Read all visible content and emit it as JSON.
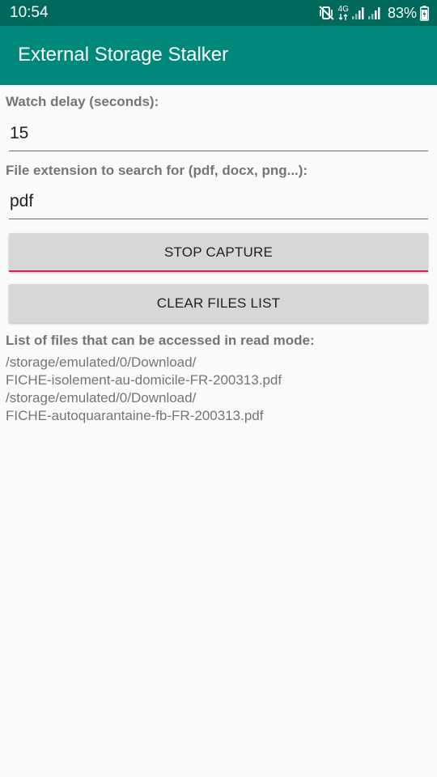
{
  "status_bar": {
    "time": "10:54",
    "network": "4G",
    "battery": "83%",
    "icons": [
      "mute-vibrate-icon",
      "network-4g-icon",
      "signal-icon",
      "battery-icon"
    ]
  },
  "app_bar": {
    "title": "External Storage Stalker"
  },
  "form": {
    "delay_label": "Watch delay (seconds):",
    "delay_value": "15",
    "extension_label": "File extension to search for (pdf, docx, png...):",
    "extension_value": "pdf"
  },
  "buttons": {
    "stop_capture": "STOP CAPTURE",
    "clear_files": "CLEAR FILES LIST"
  },
  "files": {
    "heading": "List of files that can be accessed in read mode:",
    "lines": [
      "/storage/emulated/0/Download/",
      "FICHE-isolement-au-domicile-FR-200313.pdf",
      "/storage/emulated/0/Download/",
      "FICHE-autoquarantaine-fb-FR-200313.pdf"
    ]
  },
  "colors": {
    "status_bar": "#00695c",
    "app_bar": "#00897b",
    "accent": "#d81b60",
    "background": "#fafafa"
  }
}
